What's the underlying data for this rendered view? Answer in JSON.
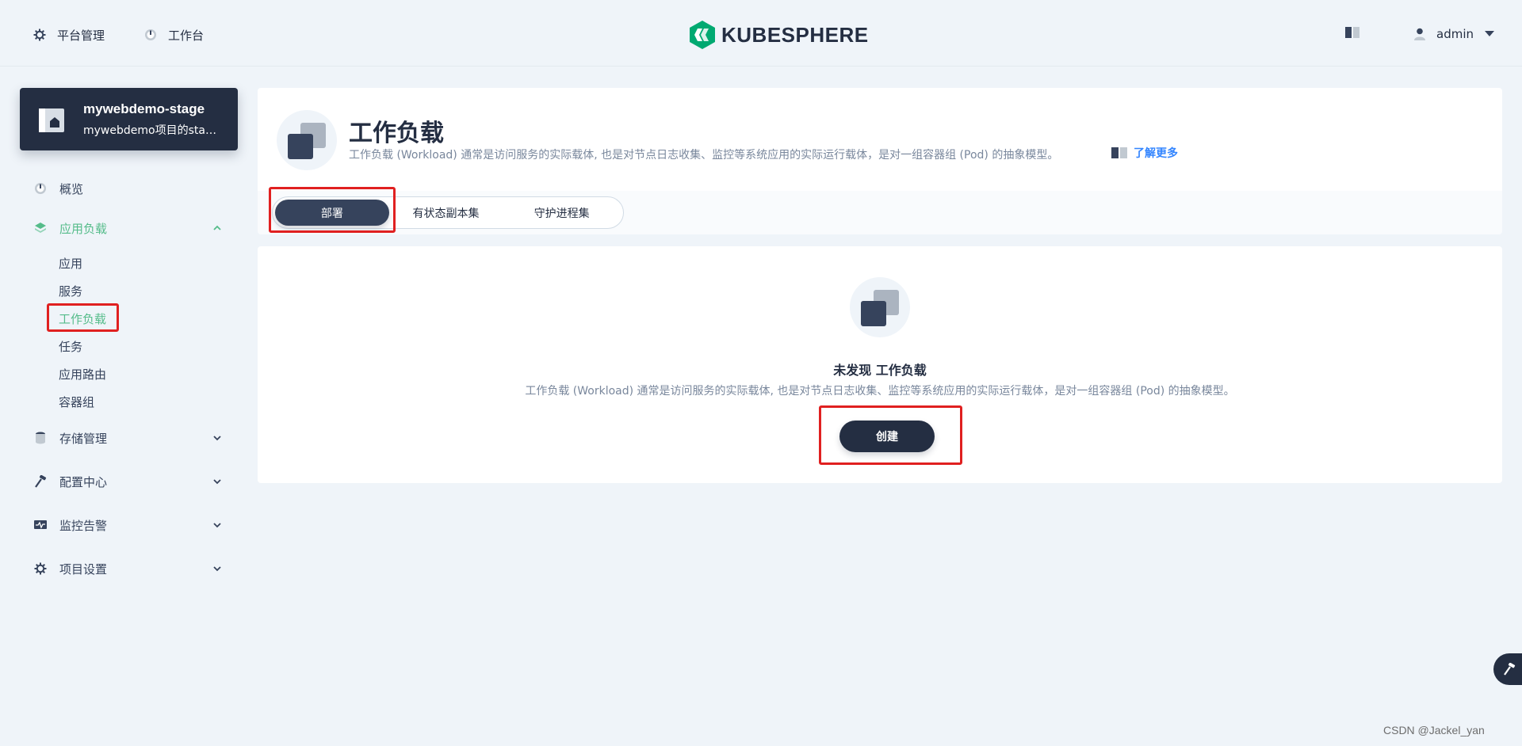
{
  "header": {
    "nav": [
      {
        "label": "平台管理",
        "icon": "gear-icon"
      },
      {
        "label": "工作台",
        "icon": "dashboard-icon"
      }
    ],
    "logo_text": "KUBESPHERE",
    "user": "admin"
  },
  "project": {
    "name": "mywebdemo-stage",
    "description": "mywebdemo项目的sta…"
  },
  "sidebar": {
    "items": [
      {
        "label": "概览",
        "icon": "dashboard-icon"
      },
      {
        "label": "应用负载",
        "icon": "layers-icon",
        "expanded": true,
        "children": [
          "应用",
          "服务",
          "工作负载",
          "任务",
          "应用路由",
          "容器组"
        ]
      },
      {
        "label": "存储管理",
        "icon": "database-icon"
      },
      {
        "label": "配置中心",
        "icon": "hammer-icon"
      },
      {
        "label": "监控告警",
        "icon": "monitor-icon"
      },
      {
        "label": "项目设置",
        "icon": "gear-icon"
      }
    ],
    "active_child": "工作负载"
  },
  "page": {
    "title": "工作负载",
    "description": "工作负载 (Workload) 通常是访问服务的实际载体, 也是对节点日志收集、监控等系统应用的实际运行载体，是对一组容器组 (Pod) 的抽象模型。",
    "learn_more": "了解更多"
  },
  "tabs": [
    "部署",
    "有状态副本集",
    "守护进程集"
  ],
  "active_tab": "部署",
  "empty_state": {
    "title": "未发现 工作负载",
    "description": "工作负载 (Workload) 通常是访问服务的实际载体, 也是对节点日志收集、监控等系统应用的实际运行载体，是对一组容器组 (Pod) 的抽象模型。",
    "create_label": "创建"
  },
  "watermark": "CSDN @Jackel_yan",
  "colors": {
    "accent_green": "#55bc8a",
    "dark": "#242e42",
    "background": "#eff4f9",
    "highlight_red": "#e02020"
  }
}
